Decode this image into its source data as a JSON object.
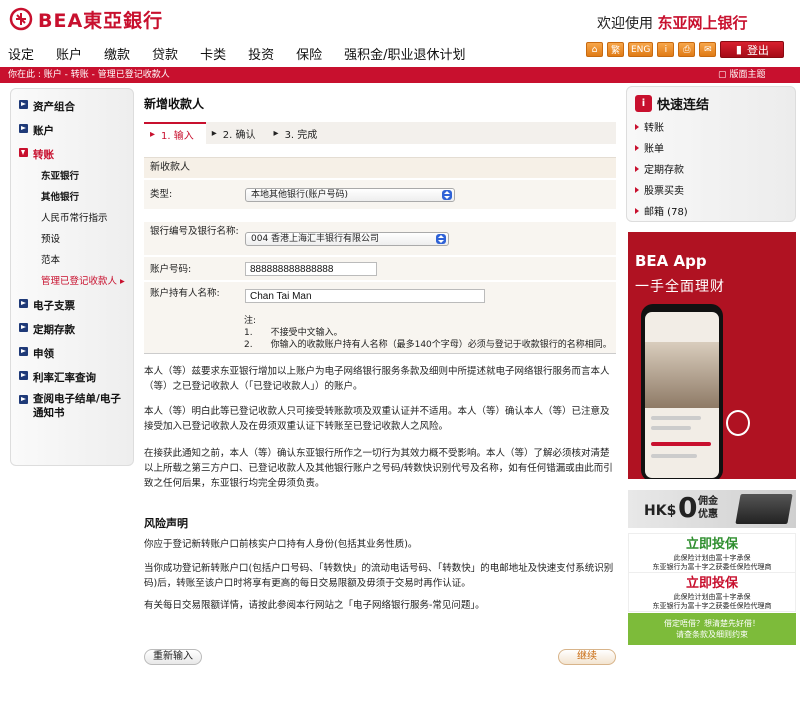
{
  "header": {
    "logo_text": "BEA東亞銀行",
    "welcome_prefix": "欢迎使用",
    "welcome_brand": "东亚网上银行",
    "nav": [
      "设定",
      "账户",
      "缴款",
      "贷款",
      "卡类",
      "投资",
      "保险",
      "强积金/职业退休计划"
    ],
    "toolbar": {
      "home": "⌂",
      "trad": "繁",
      "eng": "ENG",
      "info": "i",
      "print": "⎙",
      "mail": "✉"
    },
    "logout_label": "登出"
  },
  "redbar": {
    "breadcrumb": "你在此 : 账户 - 转账 - 管理已登记收款人",
    "theme_label": "版面主题"
  },
  "sidebar": {
    "items": [
      {
        "label": "资产组合"
      },
      {
        "label": "账户"
      },
      {
        "label": "转账"
      },
      {
        "label": "电子支票"
      },
      {
        "label": "定期存款"
      },
      {
        "label": "申领"
      },
      {
        "label": "利率汇率查询"
      },
      {
        "label": "查阅电子结单/电子通知书"
      }
    ],
    "subitems": [
      "东亚银行",
      "其他银行",
      "人民币常行指示",
      "预设",
      "范本",
      "管理已登记收款人"
    ]
  },
  "main": {
    "title": "新增收款人",
    "steps": [
      "1. 输入",
      "2. 确认",
      "3. 完成"
    ],
    "form": {
      "header": "新收款人",
      "type_label": "类型:",
      "type_value": "本地其他银行(账户号码)",
      "bank_label": "银行编号及银行名称:",
      "bank_value": "004  香港上海汇丰银行有限公司",
      "account_label": "账户号码:",
      "account_value": "888888888888888",
      "holder_label": "账户持有人名称:",
      "holder_value": "Chan Tai Man",
      "note_title": "注:",
      "notes": [
        {
          "num": "1.",
          "text": "不接受中文输入。"
        },
        {
          "num": "2.",
          "text": "你输入的收款账户持有人名称（最多140个字母）必须与登记于收款银行的名称相同。"
        }
      ]
    },
    "paragraphs": [
      "本人（等）兹要求东亚银行增加以上账户为电子网络银行服务条款及细则中所提述就电子网络银行服务而言本人（等）之已登记收款人（「已登记收款人」）的账户。",
      "本人（等）明白此等已登记收款人只可接受转账款项及双重认证并不适用。本人（等）确认本人（等）已注意及接受加入已登记收款人及在毋须双重认证下转账至已登记收款人之风险。",
      "在接获此通知之前，本人（等）确认东亚银行所作之一切行为其效力概不受影响。本人（等）了解必须核对清楚以上所载之第三方户口、已登记收款人及其他银行账户之号码/转数快识别代号及名称，如有任何错漏或由此而引致之任何后果，东亚银行均完全毋须负责。"
    ],
    "risk": {
      "title": "风险声明",
      "paragraphs": [
        "你应于登记新转账户口前核实户口持有人身份(包括其业务性质)。",
        "当你成功登记新转账户口(包括户口号码、「转数快」的流动电话号码、「转数快」的电邮地址及快速支付系统识别码)后，转账至该户口时将享有更高的每日交易限额及毋须于交易时再作认证。",
        "有关每日交易限额详情，请按此参阅本行网站之「电子网络银行服务-常见问题」。"
      ]
    },
    "reset_label": "重新输入",
    "continue_label": "继续"
  },
  "right": {
    "quick_title": "快速连结",
    "quick_icon": "i",
    "quick_links": [
      "转账",
      "账单",
      "定期存款",
      "股票买卖",
      "邮箱 (78)"
    ],
    "app_title": "BEA App",
    "app_subtitle": "一手全面理财",
    "hk_hks": "HK$",
    "hk_zero": "0",
    "hk_line1": "佣金",
    "hk_line2": "优惠",
    "ins1": {
      "title": "立即投保",
      "l1": "此保险计划由富十字承保",
      "l2": "东亚银行为富十字之获委任保险代理商"
    },
    "ins2": {
      "title": "立即投保",
      "l1": "此保险计划由富十字承保",
      "l2": "东亚银行为富十字之获委任保险代理商"
    },
    "green_l1": "借定唔借？想清楚先好借！",
    "green_l2": "请查条款及细则约束"
  }
}
